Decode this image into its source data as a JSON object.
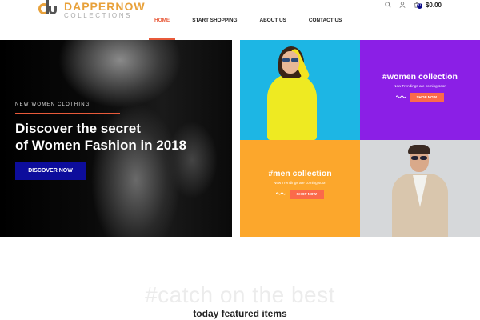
{
  "brand": {
    "title": "DAPPERNOW",
    "subtitle": "COLLECTIONS"
  },
  "header_tools": {
    "cart_count": "0",
    "cart_total": "$0.00"
  },
  "nav": {
    "items": [
      {
        "label": "HOME"
      },
      {
        "label": "START SHOPPING"
      },
      {
        "label": "ABOUT US"
      },
      {
        "label": "CONTACT US"
      }
    ]
  },
  "hero": {
    "kicker": "NEW WOMEN CLOTHING",
    "title_line1": "Discover the secret",
    "title_line2": "of Women Fashion in 2018",
    "button_label": "DISCOVER NOW"
  },
  "tiles": {
    "women": {
      "heading": "#women collection",
      "sub": "New Trendings are coming soon",
      "button_label": "SHOP NOW"
    },
    "men": {
      "heading": "#men collection",
      "sub": "New Trendings are coming soon",
      "button_label": "SHOP NOW"
    }
  },
  "featured": {
    "watermark": "#catch on the best",
    "title": "today featured items"
  },
  "colors": {
    "accent": "#e85a3a",
    "primary_button": "#0d0d9c",
    "tile_cyan": "#1db6e4",
    "tile_purple": "#8b1fe6",
    "tile_orange": "#fca72c",
    "shop_button": "#fb6a4a"
  }
}
